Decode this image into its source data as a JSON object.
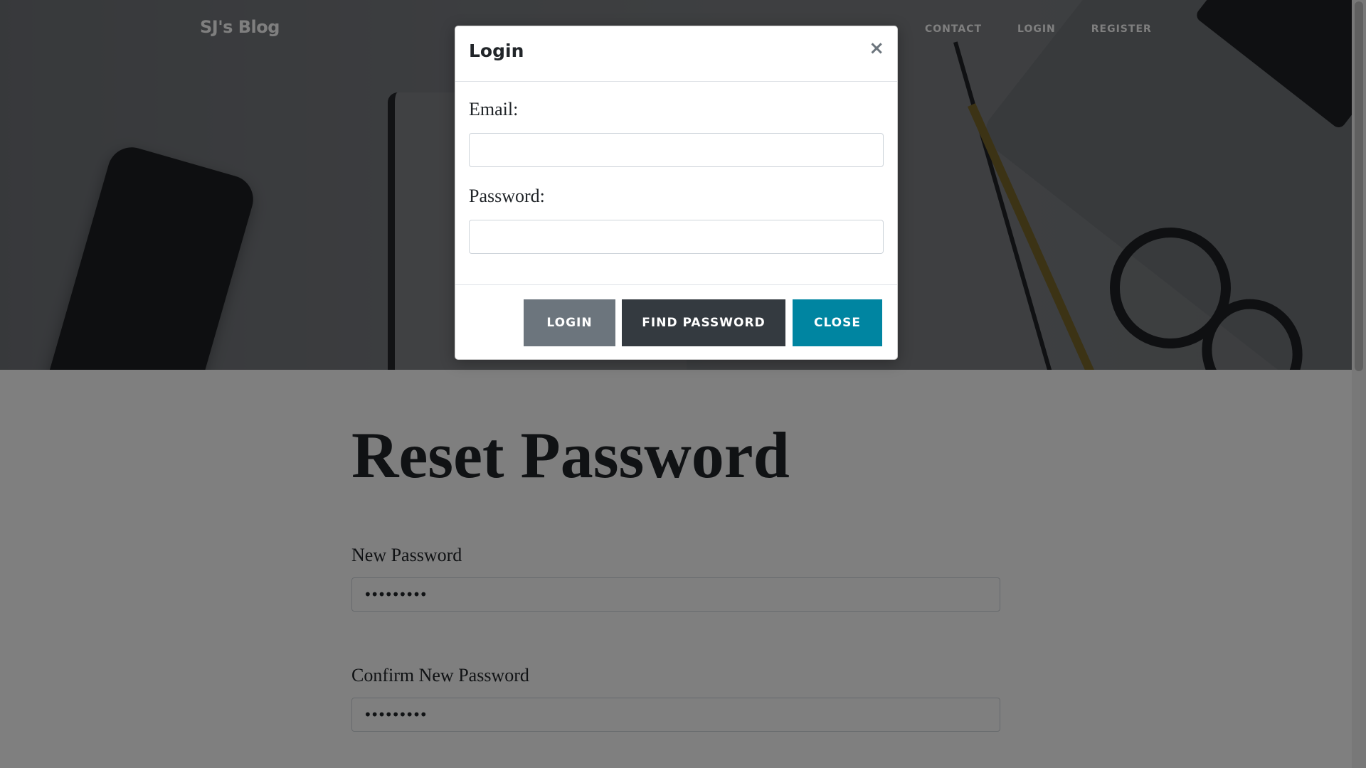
{
  "navbar": {
    "brand": "SJ's Blog",
    "links": [
      "CONTACT",
      "LOGIN",
      "REGISTER"
    ]
  },
  "main": {
    "title": "Reset Password",
    "new_password": {
      "label": "New Password",
      "value": "•••••••••"
    },
    "confirm_password": {
      "label": "Confirm New Password",
      "value": "•••••••••"
    }
  },
  "modal": {
    "title": "Login",
    "close_symbol": "×",
    "email_label": "Email:",
    "email_value": "",
    "password_label": "Password:",
    "password_value": "",
    "buttons": {
      "login": "LOGIN",
      "find_password": "FIND PASSWORD",
      "close": "CLOSE"
    }
  },
  "colors": {
    "login_button": "#6c757d",
    "find_password_button": "#343a40",
    "close_button": "#0085a1",
    "backdrop": "rgba(0,0,0,0.5)"
  }
}
